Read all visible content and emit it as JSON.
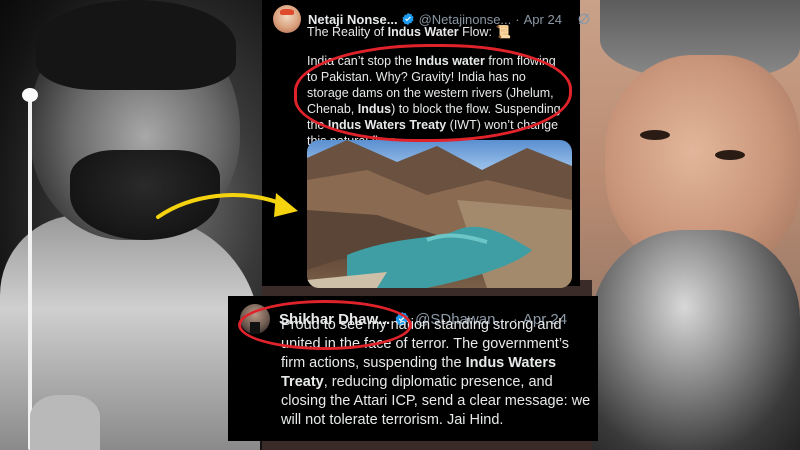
{
  "tweet_top": {
    "name": "Netaji Nonse...",
    "handle": "@Netajinonse...",
    "separator": "·",
    "date": "Apr 24",
    "title_prefix": "The Reality of ",
    "title_bold": "Indus Water",
    "title_suffix": " Flow:",
    "title_emoji": "📜",
    "body": [
      {
        "text": "India can’t stop the ",
        "bold": false
      },
      {
        "text": "Indus water",
        "bold": true
      },
      {
        "text": " from flowing to Pakistan. Why? Gravity! India has no storage dams on the western rivers (Jhelum, Chenab, ",
        "bold": false
      },
      {
        "text": "Indus",
        "bold": true
      },
      {
        "text": ") to block the flow. Suspending the ",
        "bold": false
      },
      {
        "text": "Indus Waters Treaty",
        "bold": true
      },
      {
        "text": " (IWT) won’t change this natural flow.",
        "bold": false
      }
    ]
  },
  "tweet_bottom": {
    "name": "Shikhar Dhaw...",
    "handle": "@SDhawan...",
    "separator": "·",
    "date": "Apr 24",
    "body": [
      {
        "text": "Proud to see my nation standing strong and united in the face of terror. The government’s firm actions, suspending the ",
        "bold": false
      },
      {
        "text": "Indus Waters Treaty",
        "bold": true
      },
      {
        "text": ", reducing diplomatic presence, and closing the Attari ICP, send a clear message: we will not tolerate terrorism. Jai Hind.",
        "bold": false
      }
    ]
  },
  "icons": {
    "verified": "verified-badge-icon",
    "grok": "grok-icon"
  },
  "colors": {
    "accent_red": "#e0232b",
    "arrow_yellow": "#f5d40f",
    "verified_blue": "#1d9bf0",
    "tweet_bg": "#000000",
    "muted": "#8b98a5"
  }
}
